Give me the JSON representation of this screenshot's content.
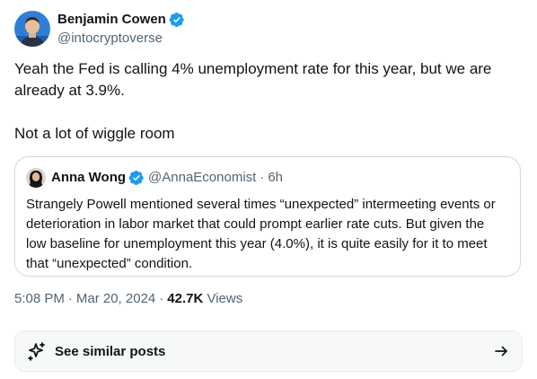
{
  "author": {
    "name": "Benjamin Cowen",
    "handle": "@intocryptoverse",
    "verified": true
  },
  "tweet": {
    "paragraphs": [
      "Yeah the Fed is calling 4% unemployment rate for this year, but we are already at 3.9%.",
      "Not a lot of wiggle room"
    ]
  },
  "quote": {
    "name": "Anna Wong",
    "handle": "@AnnaEconomist",
    "separator": "·",
    "time": "6h",
    "verified": true,
    "text": "Strangely Powell mentioned several times “unexpected” intermeeting events or deterioration in labor market that could prompt earlier rate cuts. But given the low baseline for unemployment this year (4.0%), it is quite easily for it to meet that “unexpected” condition."
  },
  "meta": {
    "time": "5:08 PM",
    "separator": "·",
    "date": "Mar 20, 2024",
    "views_count": "42.7K",
    "views_label": "Views"
  },
  "similar_posts": {
    "label": "See similar posts",
    "icon": "sparkle-icon",
    "arrow_icon": "arrow-right-icon"
  },
  "colors": {
    "verified_blue": "#1d9bf0",
    "secondary_text": "#536471",
    "primary_text": "#0f1419",
    "border": "#cfd9de"
  }
}
